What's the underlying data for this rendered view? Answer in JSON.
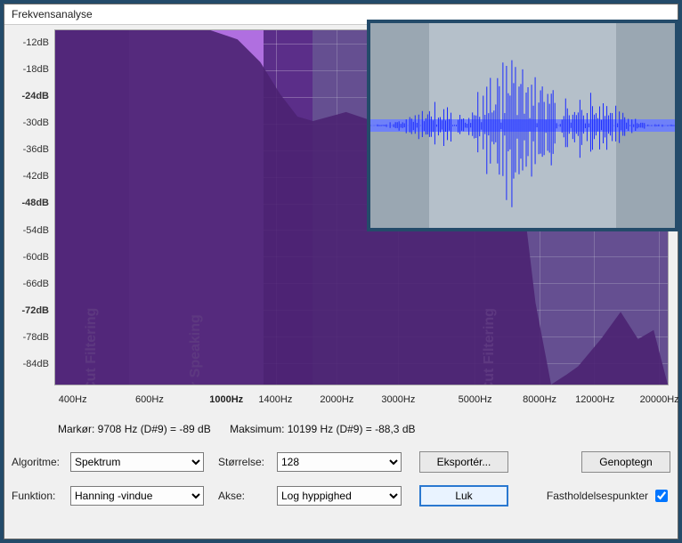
{
  "window": {
    "title": "Frekvensanalyse"
  },
  "yaxis": {
    "labels": [
      "-12dB",
      "-18dB",
      "-24dB",
      "-30dB",
      "-36dB",
      "-42dB",
      "-48dB",
      "-54dB",
      "-60dB",
      "-66dB",
      "-72dB",
      "-78dB",
      "-84dB"
    ],
    "bold_indices": [
      2,
      6,
      10
    ]
  },
  "xaxis": {
    "labels": [
      "400Hz",
      "600Hz",
      "1000Hz",
      "1400Hz",
      "2000Hz",
      "3000Hz",
      "5000Hz",
      "8000Hz",
      "12000Hz",
      "20000Hz"
    ],
    "positions_pct": [
      3,
      15.5,
      28,
      36,
      46,
      56,
      68.5,
      79,
      88,
      98.5
    ],
    "bold_indices": [
      2
    ]
  },
  "regions": [
    {
      "id": "lowcut",
      "label": "Low Cut Filtering",
      "start_pct": 0,
      "end_pct": 12,
      "fill": "#8d52bf"
    },
    {
      "id": "clear",
      "label": "Clear Speaking",
      "start_pct": 12,
      "end_pct": 34,
      "fill": "#b06fe0"
    },
    {
      "id": "highcut",
      "label": "HighCut Filtering",
      "start_pct": 42,
      "end_pct": 100,
      "fill": "rgba(120,140,160,0.35)"
    }
  ],
  "info": {
    "cursor": "Markør: 9708 Hz (D#9) = -89 dB",
    "max": "Maksimum: 10199 Hz (D#9) = -88,3 dB"
  },
  "controls": {
    "algorithm_label": "Algoritme:",
    "algorithm_value": "Spektrum",
    "size_label": "Størrelse:",
    "size_value": "128",
    "export_label": "Eksportér...",
    "redraw_label": "Genoptegn",
    "function_label": "Funktion:",
    "function_value": "Hanning -vindue",
    "axis_label": "Akse:",
    "axis_value": "Log hyppighed",
    "close_label": "Luk",
    "pin_label": "Fastholdelsespunkter",
    "pin_checked": true
  },
  "chart_data": {
    "type": "area",
    "title": "Frekvensanalyse",
    "xlabel": "Hz",
    "ylabel": "dB",
    "ylim": [
      -88,
      -10
    ],
    "x_scale": "log",
    "x": [
      350,
      400,
      600,
      800,
      1000,
      1200,
      1400,
      1600,
      1800,
      2000,
      2500,
      3000,
      4000,
      5000,
      6000,
      7000,
      8000,
      9000,
      10000,
      11000,
      12000,
      14000,
      16000,
      18000,
      20000
    ],
    "values": [
      -10,
      -10,
      -10,
      -10,
      -10,
      -12,
      -17,
      -24,
      -29,
      -30,
      -28,
      -30,
      -29,
      -29,
      -30,
      -32,
      -38,
      -70,
      -88,
      -86,
      -84,
      -78,
      -72,
      -78,
      -76
    ],
    "series": [
      {
        "name": "Low Cut Filtering",
        "approx_range_hz": [
          300,
          560
        ]
      },
      {
        "name": "Clear Speaking",
        "approx_range_hz": [
          560,
          1350
        ]
      },
      {
        "name": "HighCut Filtering",
        "approx_range_hz": [
          1700,
          22000
        ]
      }
    ],
    "cursor": {
      "hz": 9708,
      "note": "D#9",
      "db": -89
    },
    "maximum": {
      "hz": 10199,
      "note": "D#9",
      "db": -88.3
    }
  }
}
